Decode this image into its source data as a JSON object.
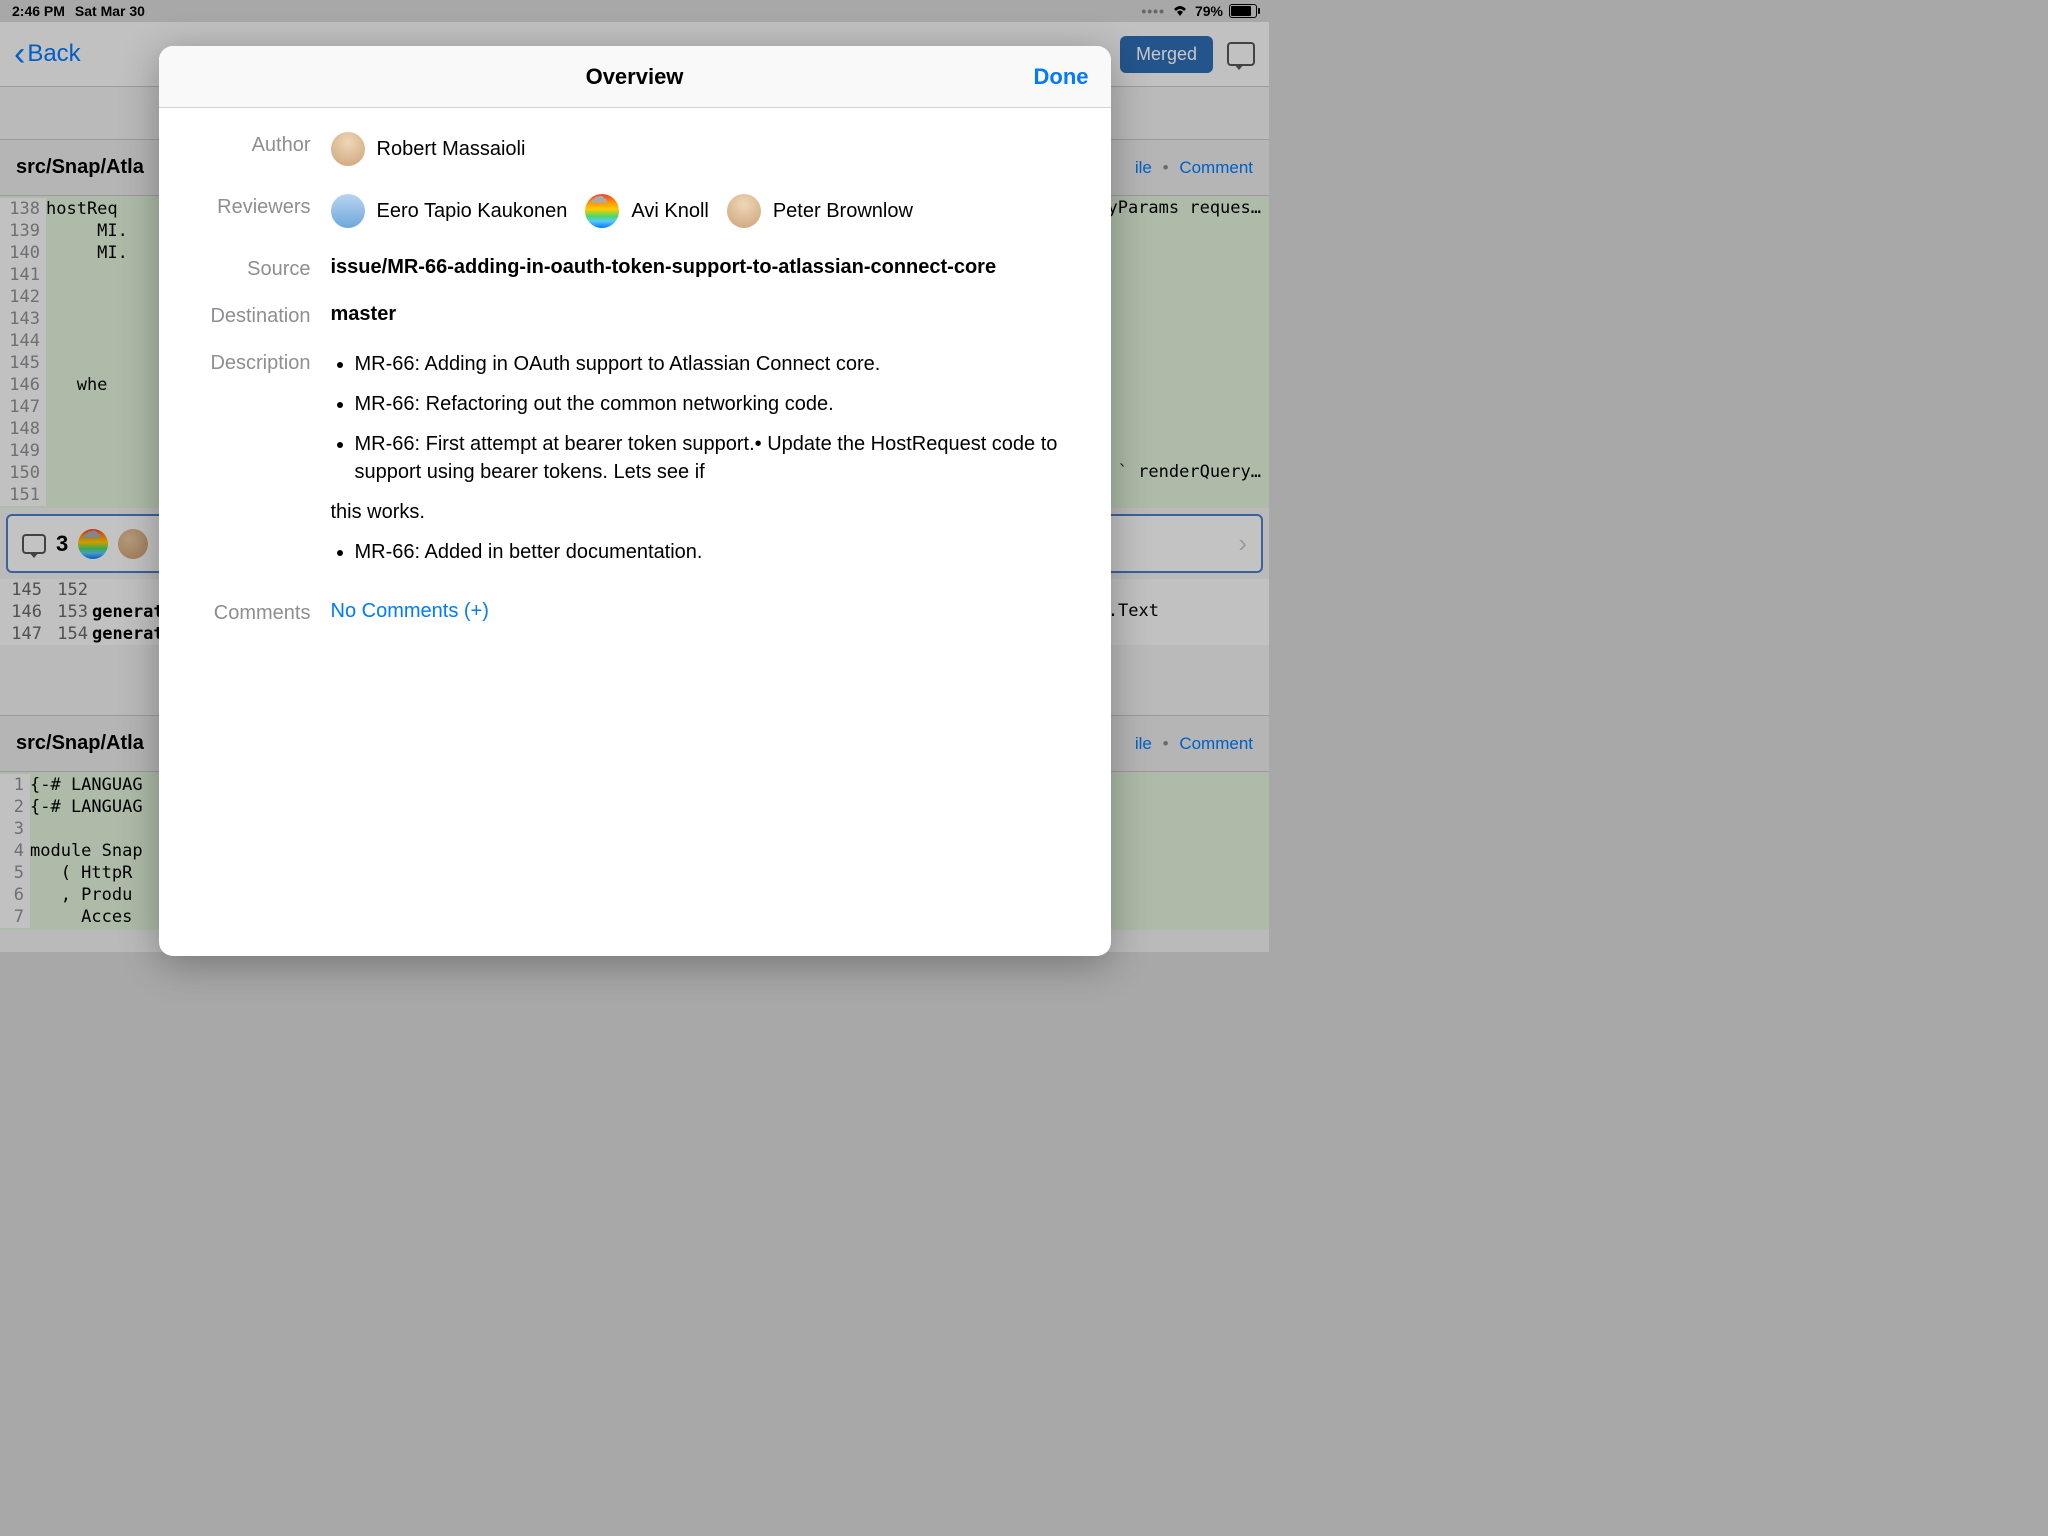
{
  "status": {
    "time": "2:46 PM",
    "date": "Sat Mar 30",
    "battery": "79%"
  },
  "nav": {
    "back": "Back",
    "merged": "Merged"
  },
  "file1": {
    "path": "src/Snap/Atla",
    "file_link": "ile",
    "comment_link": "Comment"
  },
  "code1": {
    "lines": [
      {
        "n": "138",
        "t": "hostReq"
      },
      {
        "n": "139",
        "t": "     MI."
      },
      {
        "n": "140",
        "t": "     MI."
      },
      {
        "n": "141",
        "t": ""
      },
      {
        "n": "142",
        "t": ""
      },
      {
        "n": "143",
        "t": ""
      },
      {
        "n": "144",
        "t": ""
      },
      {
        "n": "145",
        "t": ""
      },
      {
        "n": "146",
        "t": "   whe"
      },
      {
        "n": "147",
        "t": ""
      },
      {
        "n": "148",
        "t": ""
      },
      {
        "n": "149",
        "t": ""
      },
      {
        "n": "150",
        "t": ""
      },
      {
        "n": "151",
        "t": ""
      }
    ],
    "right_fragments": {
      "params": "yParams reques…",
      "render": "` renderQuery…"
    }
  },
  "comment_bar": {
    "count": "3"
  },
  "split": [
    {
      "a": "145",
      "b": "152",
      "t": ""
    },
    {
      "a": "146",
      "b": "153",
      "t": "generat"
    },
    {
      "a": "147",
      "b": "154",
      "t": "generat"
    }
  ],
  "split_right": "T.Text",
  "file2": {
    "path": "src/Snap/Atla",
    "file_link": "ile",
    "comment_link": "Comment"
  },
  "code2": [
    {
      "n": "1",
      "t": "{-# LANGUAG"
    },
    {
      "n": "2",
      "t": "{-# LANGUAG"
    },
    {
      "n": "3",
      "t": ""
    },
    {
      "n": "4",
      "t": "module Snap"
    },
    {
      "n": "5",
      "t": "   ( HttpR"
    },
    {
      "n": "6",
      "t": "   , Produ"
    },
    {
      "n": "7",
      "t": "     Acces"
    }
  ],
  "modal": {
    "title": "Overview",
    "done": "Done",
    "labels": {
      "author": "Author",
      "reviewers": "Reviewers",
      "source": "Source",
      "destination": "Destination",
      "description": "Description",
      "comments": "Comments"
    },
    "author": "Robert Massaioli",
    "reviewers": [
      "Eero Tapio Kaukonen",
      "Avi Knoll",
      "Peter Brownlow"
    ],
    "source": "issue/MR-66-adding-in-oauth-token-support-to-atlassian-connect-core",
    "destination": "master",
    "description": {
      "items1": [
        "MR-66: Adding in OAuth support to Atlassian Connect core.",
        "MR-66: Refactoring out the common networking code.",
        "MR-66: First attempt at bearer token support.•  Update the HostRequest code to support using bearer tokens. Lets see if"
      ],
      "loose": "this works.",
      "items2": [
        "MR-66: Added in better documentation."
      ]
    },
    "comments_link": "No Comments (+)"
  }
}
